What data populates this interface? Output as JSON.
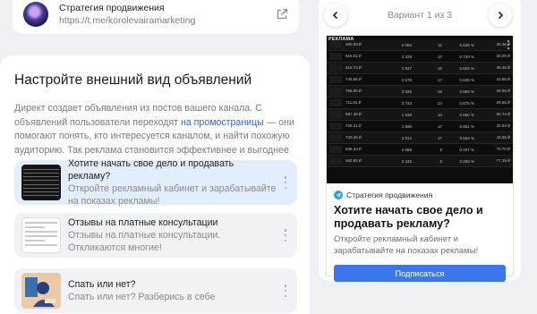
{
  "channel": {
    "name": "Стратегия продвижения",
    "url": "https://t.me/korolevairamarketing"
  },
  "settings": {
    "title": "Настройте внешний вид объявлений",
    "desc_before": "Директ создает объявления из постов вашего канала. С объявлений пользователи переходят ",
    "desc_link": "на промостраницы",
    "desc_after": " — они помогают понять, кто интересуется каналом, и найти похожую аудиторию. Так реклама становится эффективнее и выгоднее"
  },
  "options": [
    {
      "title": "Хотите начать свое дело и продавать рекламу?",
      "subtitle": "Откройте рекламный кабинет и зарабатывайте на показах рекламы!"
    },
    {
      "title": "Отзывы на платные консультации",
      "subtitle": "Отзывы на платные консультации. Откликаются многие!"
    },
    {
      "title": "Спать или нет?",
      "subtitle": "Спать или нет? Разберись в себе"
    }
  ],
  "preview": {
    "variant_label": "Вариант 1 из 3",
    "ad": {
      "image_tag": "РЕКЛАМА",
      "table_rows": [
        [
          "400.00 ₽",
          "2 094",
          "11",
          "0.525 %",
          "36.36 ₽"
        ],
        [
          "519.02 ₽",
          "2 329",
          "17",
          "0.730 %",
          "30.00 ₽"
        ],
        [
          "615.73 ₽",
          "1 937",
          "16",
          "0.826 %",
          "38.48 ₽"
        ],
        [
          "745.66 ₽",
          "2 678",
          "17",
          "0.635 %",
          "43.86 ₽"
        ],
        [
          "755.36 ₽",
          "3 026",
          "26",
          "0.859 %",
          "29.05 ₽"
        ],
        [
          "711.81 ₽",
          "2 743",
          "24",
          "0.875 %",
          "29.65 ₽"
        ],
        [
          "557.48 ₽",
          "1 538",
          "10",
          "0.650 %",
          "55.74 ₽"
        ],
        [
          "728.21 ₽",
          "1 996",
          "17",
          "0.851 %",
          "42.83 ₽"
        ],
        [
          "740.45 ₽",
          "3 012",
          "17",
          "0.564 %",
          "43.55 ₽"
        ],
        [
          "636.33 ₽",
          "2 668",
          "9",
          "0.337 %",
          "70.70 ₽"
        ],
        [
          "462.94 ₽",
          "2 345",
          "6",
          "0.256 %",
          "77.15 ₽"
        ]
      ],
      "channel": "Стратегия продвижения",
      "title": "Хотите начать свое дело и продавать рекламу?",
      "text": "Откройте рекламный кабинет и зарабатывайте на показах рекламы!",
      "button": "Подписаться"
    }
  },
  "colors": {
    "link": "#3763d9",
    "button": "#3b76ee",
    "telegram": "#2a9ee3",
    "active_option": "#e3eefc"
  }
}
